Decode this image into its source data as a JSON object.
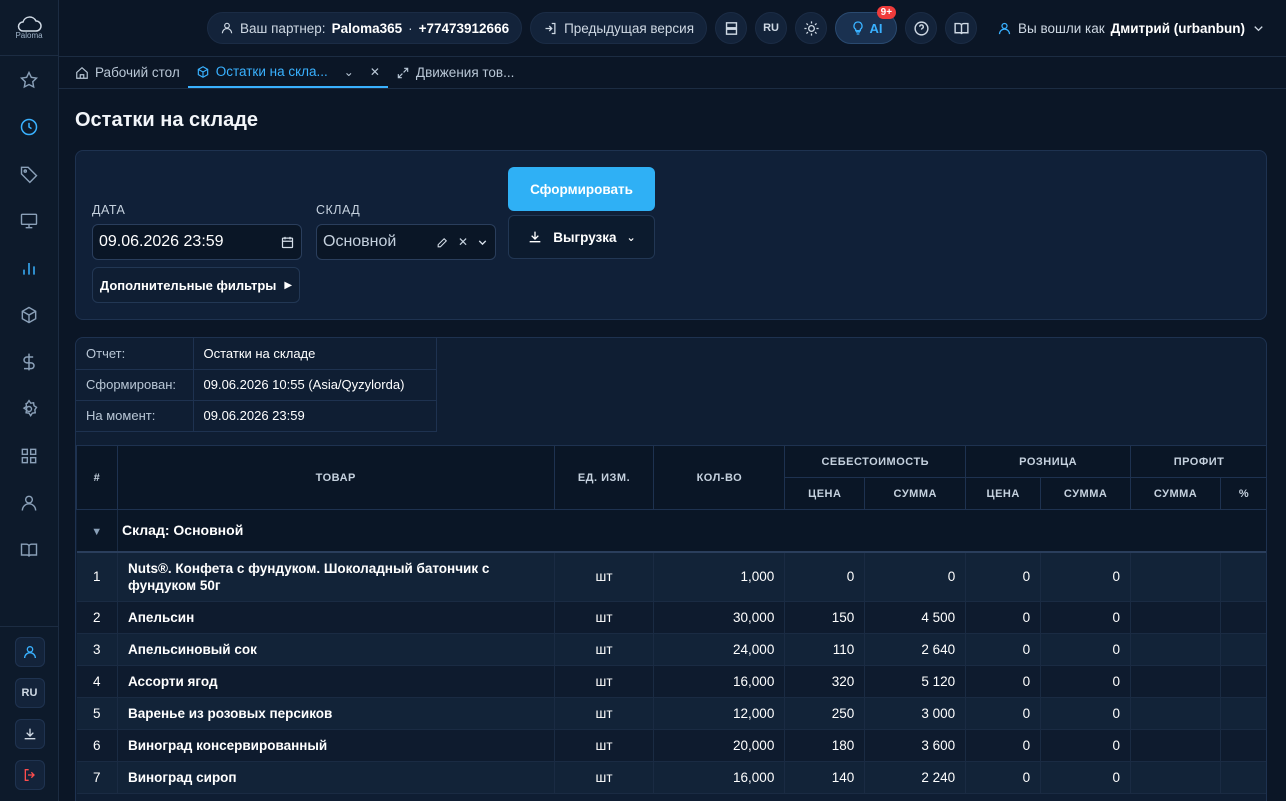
{
  "logo": {
    "text": "Paloma",
    "sup": "365"
  },
  "topbar": {
    "partner_label": "Ваш партнер:",
    "partner_name": "Paloma365",
    "partner_sep": "·",
    "partner_phone": "+77473912666",
    "prev_version": "Предыдущая версия",
    "lang": "RU",
    "ai_label": "AI",
    "ai_badge": "9+",
    "logged_in_label": "Вы вошли как",
    "user_name": "Дмитрий (urbanbun)"
  },
  "tabs": [
    {
      "label": "Рабочий стол"
    },
    {
      "label": "Остатки на скла..."
    },
    {
      "label": "Движения тов..."
    }
  ],
  "sidebar_bottom": {
    "lang": "RU"
  },
  "page": {
    "title": "Остатки на складе"
  },
  "filters": {
    "date_label": "ДАТА",
    "date_value": "09.06.2026 23:59",
    "warehouse_label": "СКЛАД",
    "warehouse_value": "Основной",
    "generate_button": "Сформировать",
    "export_button": "Выгрузка",
    "more_filters": "Дополнительные фильтры"
  },
  "report_meta": [
    {
      "key": "Отчет:",
      "value": "Остатки на складе"
    },
    {
      "key": "Сформирован:",
      "value": "09.06.2026 10:55 (Asia/Qyzylorda)"
    },
    {
      "key": "На момент:",
      "value": "09.06.2026 23:59"
    }
  ],
  "table": {
    "headers": {
      "num": "#",
      "product": "ТОВАР",
      "unit": "ЕД. ИЗМ.",
      "qty": "КОЛ-ВО",
      "cost": "СЕБЕСТОИМОСТЬ",
      "retail": "РОЗНИЦА",
      "profit": "ПРОФИТ",
      "price": "ЦЕНА",
      "sum": "СУММА",
      "pct": "%"
    },
    "group": "Склад: Основной",
    "rows": [
      {
        "n": "1",
        "name": "Nuts®. Конфета с фундуком. Шоколадный батончик с фундуком 50г",
        "unit": "шт",
        "qty": "1,000",
        "cost_price": "0",
        "cost_sum": "0",
        "retail_price": "0",
        "retail_sum": "0"
      },
      {
        "n": "2",
        "name": "Апельсин",
        "unit": "шт",
        "qty": "30,000",
        "cost_price": "150",
        "cost_sum": "4 500",
        "retail_price": "0",
        "retail_sum": "0"
      },
      {
        "n": "3",
        "name": "Апельсиновый сок",
        "unit": "шт",
        "qty": "24,000",
        "cost_price": "110",
        "cost_sum": "2 640",
        "retail_price": "0",
        "retail_sum": "0"
      },
      {
        "n": "4",
        "name": "Ассорти ягод",
        "unit": "шт",
        "qty": "16,000",
        "cost_price": "320",
        "cost_sum": "5 120",
        "retail_price": "0",
        "retail_sum": "0"
      },
      {
        "n": "5",
        "name": "Варенье из розовых персиков",
        "unit": "шт",
        "qty": "12,000",
        "cost_price": "250",
        "cost_sum": "3 000",
        "retail_price": "0",
        "retail_sum": "0"
      },
      {
        "n": "6",
        "name": "Виноград консервированный",
        "unit": "шт",
        "qty": "20,000",
        "cost_price": "180",
        "cost_sum": "3 600",
        "retail_price": "0",
        "retail_sum": "0"
      },
      {
        "n": "7",
        "name": "Виноград сироп",
        "unit": "шт",
        "qty": "16,000",
        "cost_price": "140",
        "cost_sum": "2 240",
        "retail_price": "0",
        "retail_sum": "0"
      }
    ]
  }
}
